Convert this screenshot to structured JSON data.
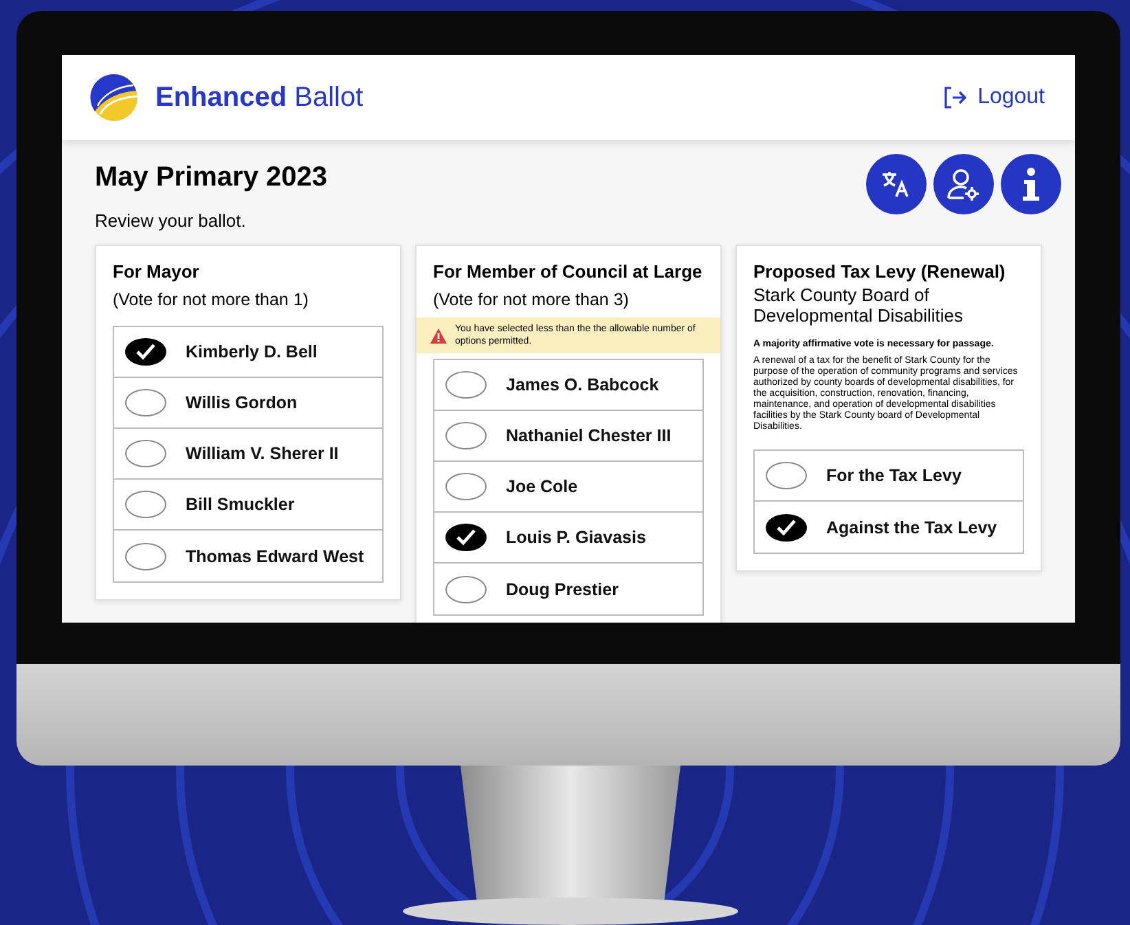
{
  "header": {
    "brand": "**Enhanced** Ballot",
    "logout": "Logout"
  },
  "page": {
    "title": "May Primary 2023",
    "subtitle": "Review your ballot."
  },
  "contests": [
    {
      "title": "For Mayor",
      "subtitle": "(Vote for not more than 1)",
      "options": [
        {
          "name": "Kimberly D. Bell",
          "selected": true
        },
        {
          "name": "Willis Gordon",
          "selected": false
        },
        {
          "name": "William V. Sherer II",
          "selected": false
        },
        {
          "name": "Bill Smuckler",
          "selected": false
        },
        {
          "name": "Thomas Edward West",
          "selected": false
        }
      ]
    },
    {
      "title": "For Member of Council at Large",
      "subtitle": "(Vote for not more than 3)",
      "warning": "You have selected less than the the allowable number of options permitted.",
      "options": [
        {
          "name": "James O. Babcock",
          "selected": false
        },
        {
          "name": "Nathaniel Chester III",
          "selected": false
        },
        {
          "name": "Joe Cole",
          "selected": false
        },
        {
          "name": "Louis P. Giavasis",
          "selected": true
        },
        {
          "name": "Doug Prestier",
          "selected": false
        }
      ]
    },
    {
      "title": "Proposed Tax Levy (Renewal)",
      "subtitle": "Stark County Board of Developmental Disabilities",
      "note": "A majority affirmative vote is necessary for passage.",
      "description": "A renewal of a tax for the benefit of Stark County for the purpose of the operation of community programs and services authorized by county boards of developmental disabilities, for the acquisition, construction, renovation, financing, maintenance, and operation of developmental disabilities facilities by the Stark County board of Developmental Disabilities.",
      "options": [
        {
          "name": "For the Tax Levy",
          "selected": false
        },
        {
          "name": "Against the Tax Levy",
          "selected": true
        }
      ]
    }
  ]
}
